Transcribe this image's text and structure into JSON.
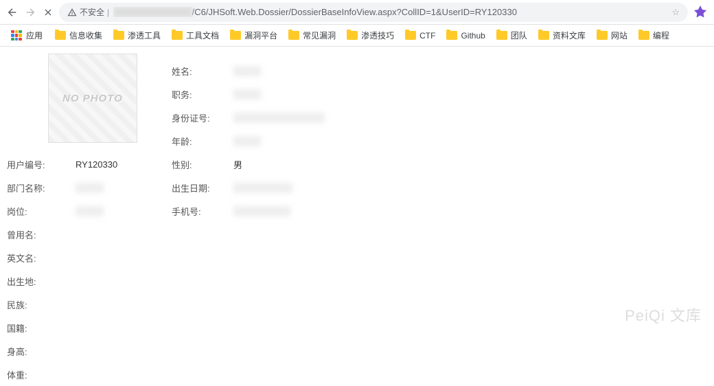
{
  "nav": {
    "insecure_label": "不安全",
    "url_prefix": "/C6/JHSoft.Web.Dossier/DossierBaseInfoView.aspx?CollID=1&UserID=RY120330"
  },
  "bookmarks": {
    "apps_label": "应用",
    "items": [
      "信息收集",
      "渗透工具",
      "工具文档",
      "漏洞平台",
      "常见漏洞",
      "渗透技巧",
      "CTF",
      "Github",
      "团队",
      "资料文库",
      "网站",
      "编程"
    ]
  },
  "photo_placeholder": "NO PHOTO",
  "left_fields": [
    {
      "label": "用户编号:",
      "value": "RY120330",
      "blur": false
    },
    {
      "label": "部门名称:",
      "value": "████",
      "blur": true
    },
    {
      "label": "岗位:",
      "value": "████",
      "blur": true
    },
    {
      "label": "曾用名:",
      "value": "",
      "blur": false
    },
    {
      "label": "英文名:",
      "value": "",
      "blur": false
    },
    {
      "label": "出生地:",
      "value": "",
      "blur": false
    },
    {
      "label": "民族:",
      "value": "",
      "blur": false
    },
    {
      "label": "国籍:",
      "value": "",
      "blur": false
    },
    {
      "label": "身高:",
      "value": "",
      "blur": false
    },
    {
      "label": "体重:",
      "value": "",
      "blur": false
    }
  ],
  "right_fields": [
    {
      "label": "姓名:",
      "value": "███",
      "blur": true
    },
    {
      "label": "职务:",
      "value": "███",
      "blur": true
    },
    {
      "label": "身份证号:",
      "value": "██████████████",
      "blur": true
    },
    {
      "label": "年龄:",
      "value": "██",
      "blur": true
    },
    {
      "label": "性别:",
      "value": "男",
      "blur": false
    },
    {
      "label": "出生日期:",
      "value": "████-██-██",
      "blur": true
    },
    {
      "label": "手机号:",
      "value": "███████13",
      "blur": true
    }
  ],
  "watermark": "PeiQi 文库"
}
